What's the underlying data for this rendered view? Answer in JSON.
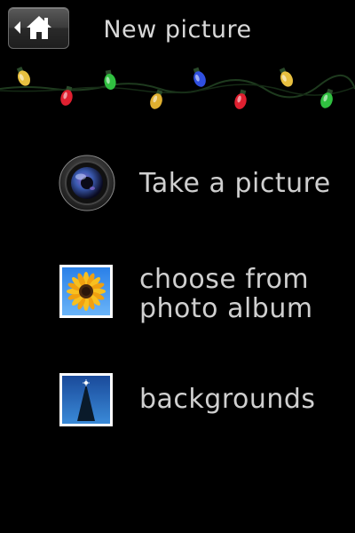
{
  "header": {
    "title": "New picture",
    "home_icon": "home-icon"
  },
  "decoration": {
    "icon": "christmas-lights-icon",
    "bulb_colors": [
      "#e8c040",
      "#e02030",
      "#30c040",
      "#e0b030",
      "#3050e0",
      "#e02030",
      "#e8c040",
      "#30c040"
    ]
  },
  "menu": {
    "items": [
      {
        "label": "Take a picture",
        "icon": "camera-lens-icon"
      },
      {
        "label": "choose from\nphoto album",
        "icon": "sunflower-photo-icon"
      },
      {
        "label": "backgrounds",
        "icon": "christmas-tree-icon"
      }
    ]
  }
}
